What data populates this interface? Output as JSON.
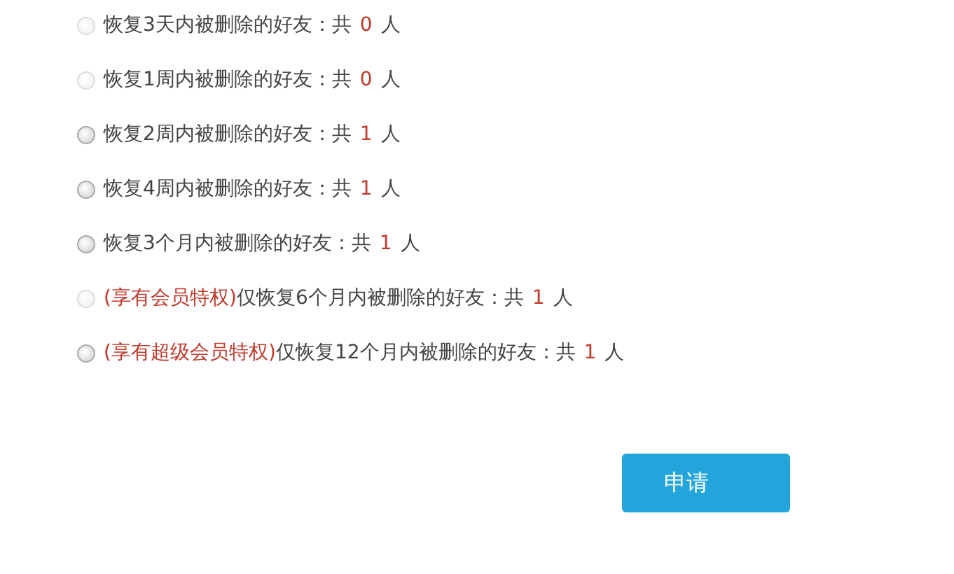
{
  "options": [
    {
      "label": "恢复3天内被删除的好友：共",
      "count": "0",
      "unit": "人",
      "selected": false,
      "disabled": true
    },
    {
      "label": "恢复1周内被删除的好友：共",
      "count": "0",
      "unit": "人",
      "selected": false,
      "disabled": true
    },
    {
      "label": "恢复2周内被删除的好友：共",
      "count": "1",
      "unit": "人",
      "selected": false,
      "disabled": false
    },
    {
      "label": "恢复4周内被删除的好友：共",
      "count": "1",
      "unit": "人",
      "selected": false,
      "disabled": false
    },
    {
      "label": "恢复3个月内被删除的好友：共",
      "count": "1",
      "unit": "人",
      "selected": false,
      "disabled": false
    },
    {
      "privilege": "(享有会员特权)",
      "label": "仅恢复6个月内被删除的好友：共",
      "count": "1",
      "unit": "人",
      "selected": false,
      "disabled": true
    },
    {
      "privilege": "(享有超级会员特权)",
      "label": "仅恢复12个月内被删除的好友：共",
      "count": "1",
      "unit": "人",
      "selected": false,
      "disabled": false
    }
  ],
  "button": {
    "label": "申请"
  }
}
